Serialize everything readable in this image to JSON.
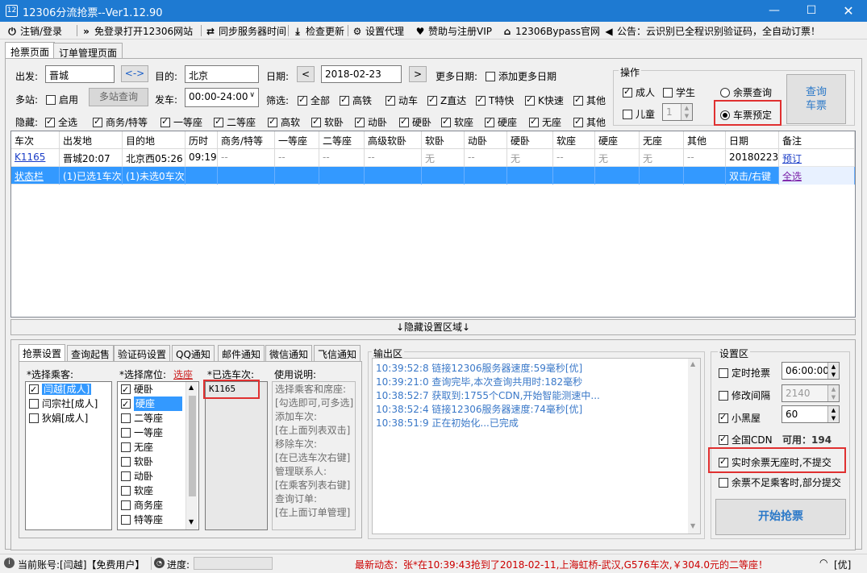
{
  "window": {
    "title": "12306分流抢票--Ver1.12.90",
    "icon_text": "12"
  },
  "menu": [
    {
      "icon": "logout-icon",
      "glyph": "⏻",
      "label": "注销/登录"
    },
    {
      "icon": "double-chevron-icon",
      "glyph": "»",
      "label": "免登录打开12306网站"
    },
    {
      "icon": "sync-icon",
      "glyph": "⇄",
      "label": "同步服务器时间"
    },
    {
      "icon": "download-icon",
      "glyph": "⤓",
      "label": "检查更新"
    },
    {
      "icon": "gear-icon",
      "glyph": "⚙",
      "label": "设置代理"
    },
    {
      "icon": "heart-icon",
      "glyph": "♥",
      "label": "赞助与注册VIP"
    },
    {
      "icon": "home-icon",
      "glyph": "⌂",
      "label": "12306Bypass官网"
    },
    {
      "icon": "speaker-icon",
      "glyph": "◀",
      "label": "公告：云识别已全程识别验证码，全自动订票！"
    }
  ],
  "tabs": [
    "抢票页面",
    "订单管理页面"
  ],
  "search": {
    "from_label": "出发:",
    "from_value": "晋城",
    "swap_label": "<->",
    "to_label": "目的:",
    "to_value": "北京",
    "date_label": "日期:",
    "date_prev": "<",
    "date_value": "2018-02-23",
    "date_next": ">",
    "more_dates_label": "更多日期:",
    "add_more_dates": "添加更多日期",
    "multi_station_label": "多站:",
    "enable_label": "启用",
    "multi_query_btn": "多站查询",
    "depart_label": "发车:",
    "depart_value": "00:00-24:00",
    "filter_label": "筛选:",
    "filters": [
      "全部",
      "高铁",
      "动车",
      "Z直达",
      "T特快",
      "K快速",
      "其他"
    ],
    "hide_label": "隐藏:",
    "hide_items": [
      "全选",
      "商务/特等",
      "一等座",
      "二等座",
      "高软",
      "软卧",
      "动卧",
      "硬卧",
      "软座",
      "硬座",
      "无座",
      "其他"
    ]
  },
  "operation": {
    "title": "操作",
    "adult": "成人",
    "student": "学生",
    "child": "儿童",
    "child_count": "1",
    "radio_query": "余票查询",
    "radio_book": "车票预定",
    "query_btn_line1": "查询",
    "query_btn_line2": "车票"
  },
  "table": {
    "headers": [
      "车次",
      "出发地",
      "目的地",
      "历时",
      "商务/特等",
      "一等座",
      "二等座",
      "高级软卧",
      "软卧",
      "动卧",
      "硬卧",
      "软座",
      "硬座",
      "无座",
      "其他",
      "日期",
      "备注"
    ],
    "rows": [
      [
        "K1165",
        "晋城20:07",
        "北京西05:26",
        "09:19",
        "--",
        "--",
        "--",
        "--",
        "无",
        "--",
        "无",
        "--",
        "无",
        "无",
        "--",
        "20180223",
        "预订"
      ],
      [
        "状态栏",
        "(1)已选1车次",
        "(1)未选0车次",
        "",
        "",
        "",
        "",
        "",
        "",
        "",
        "",
        "",
        "",
        "",
        "",
        "双击/右键",
        "全选"
      ]
    ]
  },
  "hide_area_label": "↓隐藏设置区域↓",
  "subtabs": [
    "抢票设置",
    "查询起售",
    "验证码设置",
    "QQ通知",
    "邮件通知",
    "微信通知",
    "飞信通知"
  ],
  "passengers": {
    "title": "*选择乘客:",
    "items": [
      "闫越[成人]",
      "闫宗社[成人]",
      "狄娟[成人]"
    ]
  },
  "seats": {
    "title": "*选择席位:",
    "link": "选座",
    "items": [
      "硬卧",
      "硬座",
      "二等座",
      "一等座",
      "无座",
      "软卧",
      "动卧",
      "软座",
      "商务座",
      "特等座"
    ]
  },
  "selected_trains": {
    "title": "*已选车次:",
    "items": [
      "K1165"
    ]
  },
  "usage": {
    "title": "使用说明:",
    "lines": [
      "选择乘客和席座:",
      "[勾选即可,可多选]",
      "添加车次:",
      "[在上面列表双击]",
      "移除车次:",
      "[在已选车次右键]",
      "管理联系人:",
      "[在乘客列表右键]",
      "查询订单:",
      "[在上面订单管理]"
    ]
  },
  "output": {
    "title": "输出区",
    "lines": [
      "10:39:52:8  链接12306服务器速度:59毫秒[优]",
      "10:39:21:0  查询完毕,本次查询共用时:182毫秒",
      "10:38:52:7  获取到:1755个CDN,开始智能测速中...",
      "10:38:52:4  链接12306服务器速度:74毫秒[优]",
      "10:38:51:9  正在初始化...已完成"
    ]
  },
  "settings": {
    "title": "设置区",
    "timed_label": "定时抢票",
    "timed_value": "06:00:00",
    "interval_label": "修改间隔",
    "interval_value": "2140",
    "blackroom_label": "小黑屋",
    "blackroom_value": "60",
    "cdn_label": "全国CDN",
    "cdn_avail": "可用：194",
    "no_seat_label": "实时余票无座时,不提交",
    "partial_label": "余票不足乘客时,部分提交",
    "start_btn": "开始抢票"
  },
  "status": {
    "account": "当前账号:[闫越]【免费用户】",
    "progress_label": "进度:",
    "news": "最新动态：张*在10:39:43抢到了2018-02-11,上海虹桥-武汉,G576车次,￥304.0元的二等座！",
    "signal": "[优]"
  },
  "colors": {
    "titlebar": "#1e7ad2",
    "selection": "#3399ff",
    "highlight_box": "#e03030",
    "log_text": "#3a78c8",
    "news_text": "#cc0000"
  }
}
